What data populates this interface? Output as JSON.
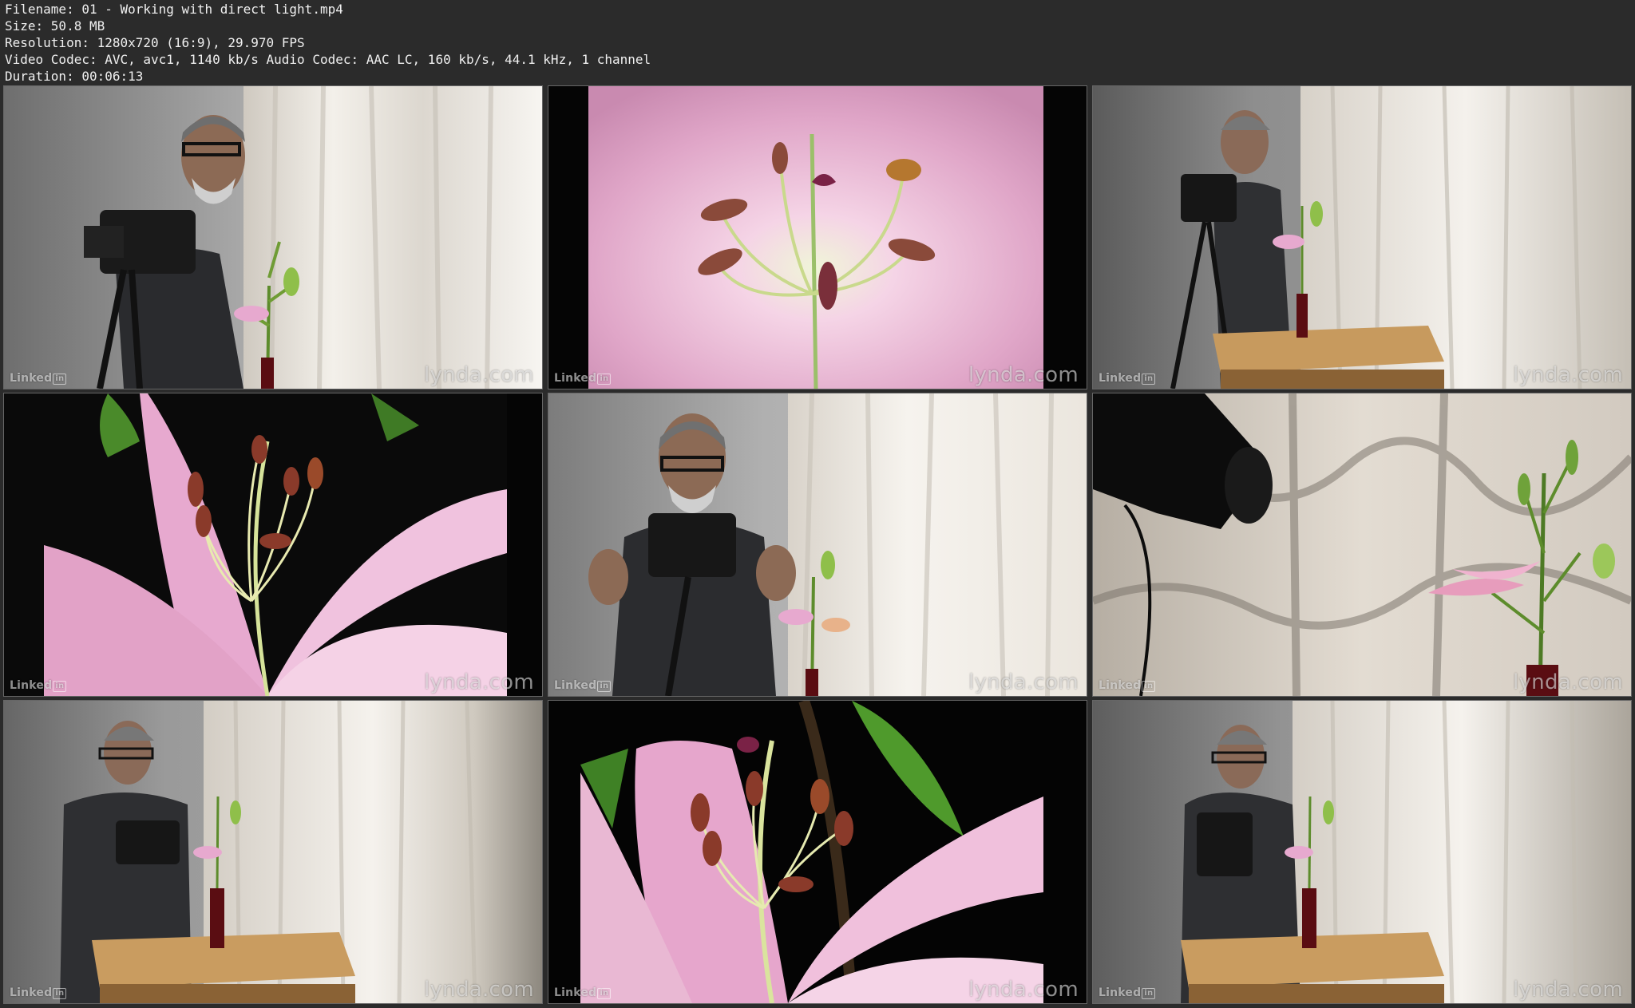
{
  "file_info": {
    "filename": "Filename: 01 - Working with direct light.mp4",
    "size": "Size: 50.8 MB",
    "resolution": "Resolution: 1280x720 (16:9), 29.970 FPS",
    "codec": "Video Codec: AVC, avc1, 1140 kb/s Audio Codec: AAC LC, 160 kb/s, 44.1 kHz, 1 channel",
    "duration": "Duration: 00:06:13"
  },
  "watermark": {
    "left_text": "Linked",
    "left_badge": "in",
    "right_text": "lynda.com"
  },
  "thumbnails": [
    {
      "scene": "presenter-with-camera-near-curtain"
    },
    {
      "scene": "lily-macro-closeup"
    },
    {
      "scene": "presenter-looking-through-camera-table-lily"
    },
    {
      "scene": "lily-closeup-dark-background"
    },
    {
      "scene": "presenter-gesturing-center"
    },
    {
      "scene": "camera-lens-shadow-on-curtain-lily"
    },
    {
      "scene": "presenter-with-camera-table-vase"
    },
    {
      "scene": "lily-closeup-green-leaves"
    },
    {
      "scene": "presenter-table-vase-right"
    }
  ],
  "colors": {
    "background": "#2b2b2b",
    "header_text": "#f0f0f0",
    "lily_pink": "#e7a9cf",
    "curtain": "#ece7df"
  }
}
